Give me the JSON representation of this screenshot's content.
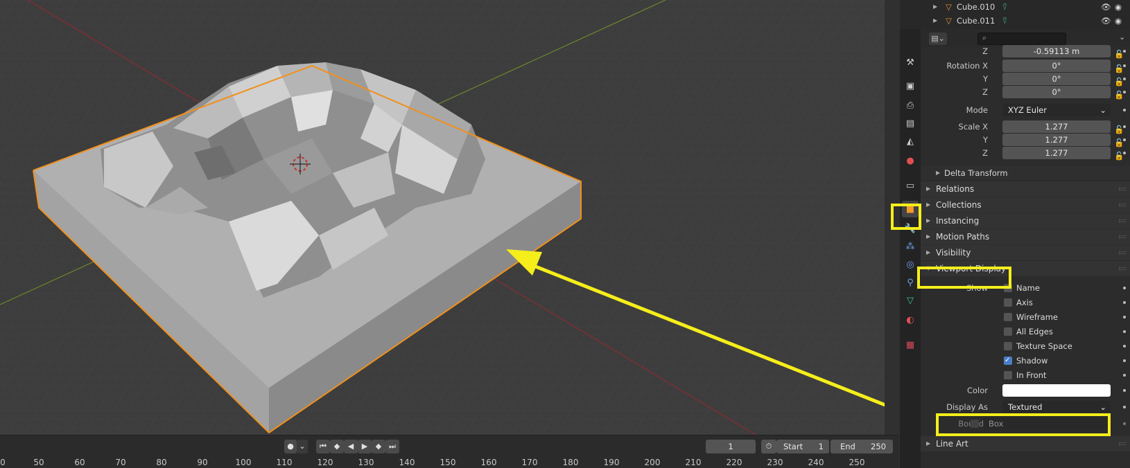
{
  "outliner": {
    "items": [
      {
        "name": "Cube.010"
      },
      {
        "name": "Cube.011"
      }
    ]
  },
  "properties": {
    "location_z": {
      "label": "Z",
      "value": "-0.59113 m"
    },
    "rotation": {
      "label_x": "Rotation X",
      "x": "0°",
      "label_y": "Y",
      "y": "0°",
      "label_z": "Z",
      "z": "0°"
    },
    "mode": {
      "label": "Mode",
      "value": "XYZ Euler"
    },
    "scale": {
      "label_x": "Scale X",
      "x": "1.277",
      "label_y": "Y",
      "y": "1.277",
      "label_z": "Z",
      "z": "1.277"
    },
    "delta_transform": "Delta Transform",
    "panels": [
      "Relations",
      "Collections",
      "Instancing",
      "Motion Paths",
      "Visibility"
    ],
    "viewport_display": {
      "title": "Viewport Display",
      "show_label": "Show",
      "options": [
        {
          "label": "Name",
          "checked": false
        },
        {
          "label": "Axis",
          "checked": false
        },
        {
          "label": "Wireframe",
          "checked": false
        },
        {
          "label": "All Edges",
          "checked": false
        },
        {
          "label": "Texture Space",
          "checked": false
        },
        {
          "label": "Shadow",
          "checked": true
        },
        {
          "label": "In Front",
          "checked": false
        }
      ],
      "color_label": "Color",
      "color_value": "#ffffff",
      "display_as_label": "Display As",
      "display_as_value": "Textured",
      "bounds_label": "Bounds",
      "bounds_value": "Box"
    },
    "line_art": "Line Art"
  },
  "timeline": {
    "current_frame": "1",
    "start_label": "Start",
    "start_value": "1",
    "end_label": "End",
    "end_value": "250",
    "ruler": [
      "0",
      "50",
      "60",
      "70",
      "80",
      "90",
      "100",
      "110",
      "120",
      "130",
      "140",
      "150",
      "160",
      "170",
      "180",
      "190",
      "200",
      "210",
      "220",
      "230",
      "240",
      "250"
    ]
  },
  "colors": {
    "highlight": "#f5ee1b",
    "selection_outline": "#f0901c",
    "checkbox_on": "#4a7fc8"
  }
}
